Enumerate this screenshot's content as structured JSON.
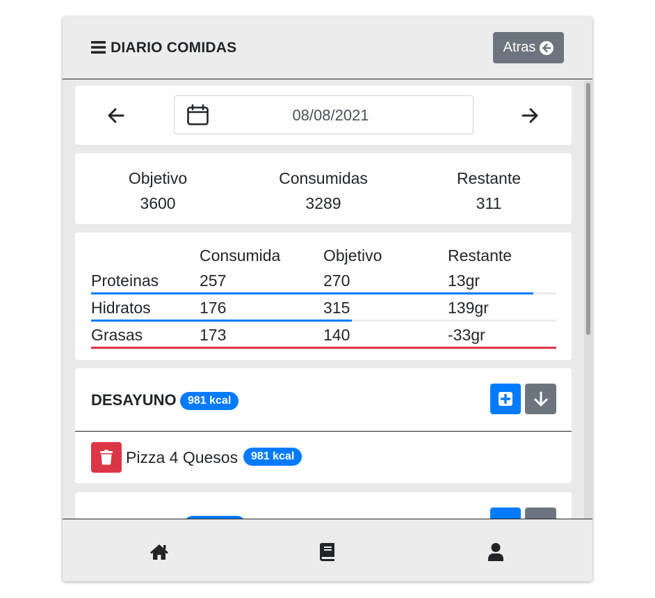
{
  "header": {
    "title": "DIARIO COMIDAS",
    "back_label": "Atras"
  },
  "date_nav": {
    "date": "08/08/2021"
  },
  "summary": [
    {
      "label": "Objetivo",
      "value": "3600"
    },
    {
      "label": "Consumidas",
      "value": "3289"
    },
    {
      "label": "Restante",
      "value": "311"
    }
  ],
  "macros": {
    "headers": [
      "Consumida",
      "Objetivo",
      "Restante"
    ],
    "rows": [
      {
        "name": "Proteinas",
        "consumed": "257",
        "goal": "270",
        "remaining": "13gr",
        "progress": 0.95,
        "color": "#007bff"
      },
      {
        "name": "Hidratos",
        "consumed": "176",
        "goal": "315",
        "remaining": "139gr",
        "progress": 0.56,
        "color": "#007bff"
      },
      {
        "name": "Grasas",
        "consumed": "173",
        "goal": "140",
        "remaining": "-33gr",
        "progress": 1.0,
        "color": "#dc3545"
      }
    ]
  },
  "meals": [
    {
      "name": "DESAYUNO",
      "kcal": "981 kcal",
      "items": [
        {
          "name": "Pizza 4 Quesos",
          "kcal": "981 kcal"
        }
      ]
    }
  ],
  "colors": {
    "primary": "#007bff",
    "secondary": "#6c757d",
    "danger": "#dc3545"
  },
  "bottom_nav": [
    "home-icon",
    "book-icon",
    "user-icon"
  ]
}
